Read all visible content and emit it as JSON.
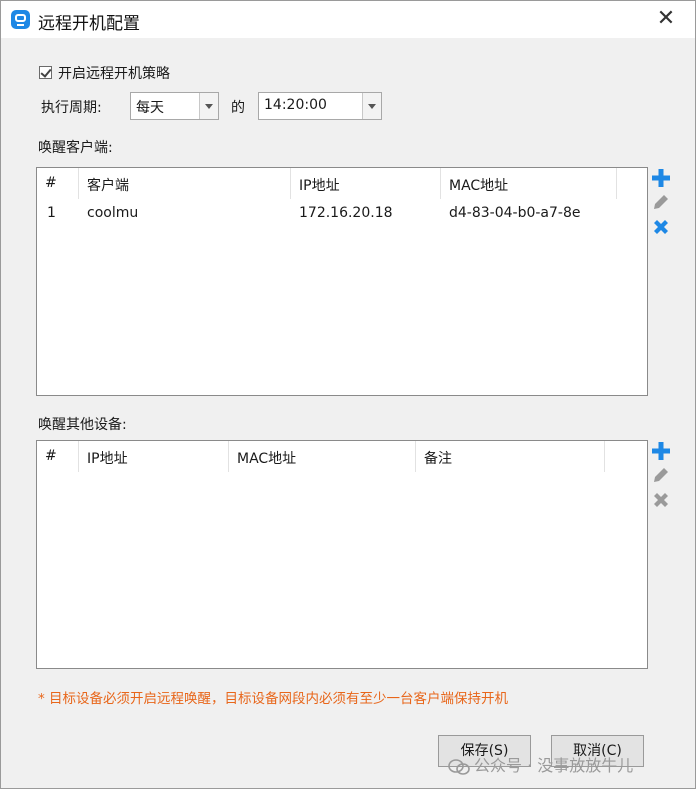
{
  "window": {
    "title": "远程开机配置",
    "close_label": "✕"
  },
  "policy": {
    "enable_label": "开启远程开机策略",
    "enabled": true,
    "cycle_label": "执行周期:",
    "cycle_value": "每天",
    "at_label": "的",
    "time_value": "14:20:00"
  },
  "clients": {
    "section_label": "唤醒客户端:",
    "columns": [
      "#",
      "客户端",
      "IP地址",
      "MAC地址"
    ],
    "rows": [
      {
        "index": "1",
        "name": "coolmu",
        "ip": "172.16.20.18",
        "mac": "d4-83-04-b0-a7-8e"
      }
    ]
  },
  "devices": {
    "section_label": "唤醒其他设备:",
    "columns": [
      "#",
      "IP地址",
      "MAC地址",
      "备注"
    ],
    "rows": []
  },
  "note": "* 目标设备必须开启远程唤醒，目标设备网段内必须有至少一台客户端保持开机",
  "buttons": {
    "save": "保存(S)",
    "cancel": "取消(C)"
  },
  "watermark": "公众号 · 没事放放牛儿",
  "colors": {
    "accent": "#1e88e5",
    "note": "#e8661a",
    "icon_disabled": "#9a9a9a"
  },
  "icons": {
    "add": "plus-icon",
    "edit": "pencil-icon",
    "delete": "x-icon"
  }
}
